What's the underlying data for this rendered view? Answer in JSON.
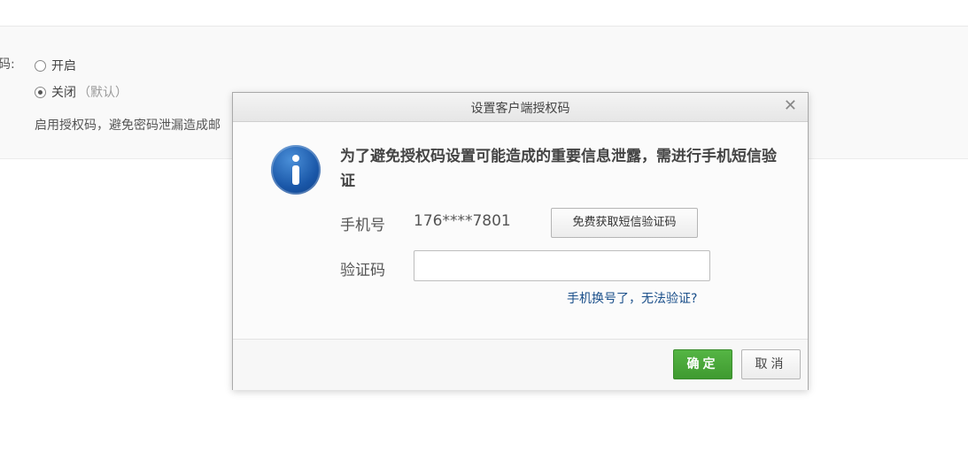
{
  "background": {
    "field_label_fragment": "码:",
    "radio_options": [
      {
        "label": "开启",
        "hint": "",
        "checked": false
      },
      {
        "label": "关闭",
        "hint": "（默认）",
        "checked": true
      }
    ],
    "description": "启用授权码，避免密码泄漏造成邮"
  },
  "dialog": {
    "title": "设置客户端授权码",
    "close_symbol": "✕",
    "notice": "为了避免授权码设置可能造成的重要信息泄露，需进行手机短信验证",
    "phone_label": "手机号",
    "phone_value": "176****7801",
    "sms_button_label": "免费获取短信验证码",
    "code_label": "验证码",
    "code_value": "",
    "code_placeholder": "",
    "help_link": "手机换号了，无法验证?",
    "ok_label": "确定",
    "cancel_label": "取消"
  },
  "colors": {
    "primary_green": "#4caf3a",
    "link_blue": "#1a4f8a",
    "info_blue": "#1a57a8"
  },
  "icons": {
    "info": "info-circle-icon",
    "close": "close-icon"
  }
}
